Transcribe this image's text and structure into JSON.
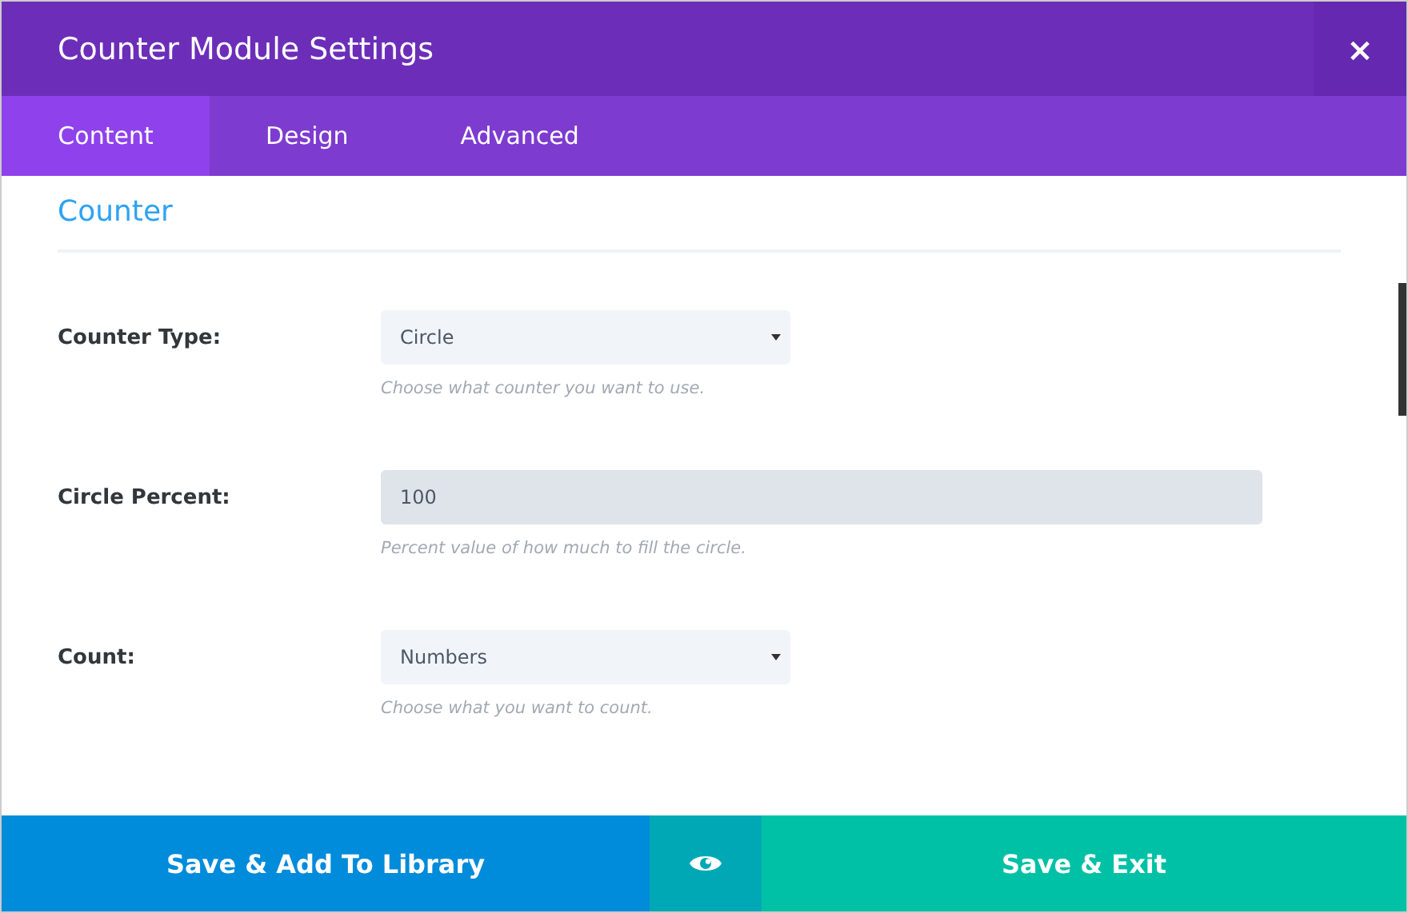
{
  "window": {
    "title": "Counter Module Settings",
    "close": "×"
  },
  "tabs": [
    {
      "label": "Content",
      "selected": true
    },
    {
      "label": "Design",
      "selected": false
    },
    {
      "label": "Advanced",
      "selected": false
    }
  ],
  "section": {
    "title": "Counter"
  },
  "fields": [
    {
      "kind": "select",
      "label": "Counter Type:",
      "value": "Circle",
      "description": "Choose what counter you want to use."
    },
    {
      "kind": "text",
      "label": "Circle Percent:",
      "value": "100",
      "description": "Percent value of how much to fill the circle."
    },
    {
      "kind": "select",
      "label": "Count:",
      "value": "Numbers",
      "description": "Choose what you want to count."
    }
  ],
  "footer": {
    "save_library": "Save & Add To Library",
    "save_exit": "Save & Exit"
  }
}
